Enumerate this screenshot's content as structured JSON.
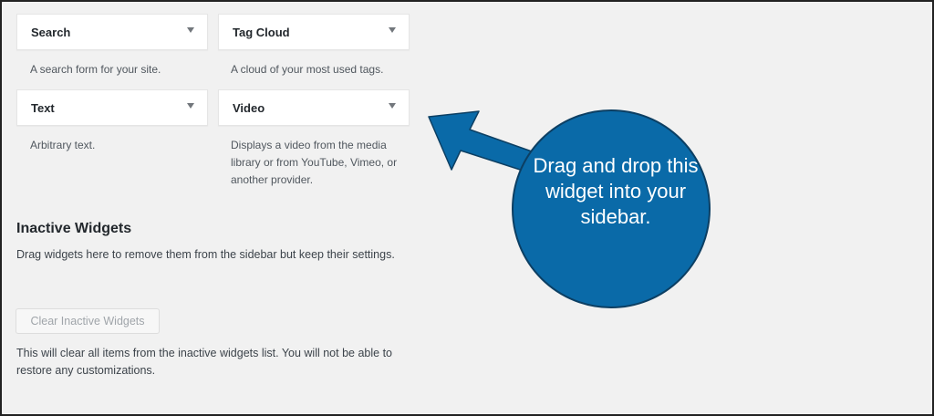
{
  "widgets": [
    {
      "title": "Search",
      "description": "A search form for your site."
    },
    {
      "title": "Tag Cloud",
      "description": "A cloud of your most used tags."
    },
    {
      "title": "Text",
      "description": "Arbitrary text."
    },
    {
      "title": "Video",
      "description": "Displays a video from the media library or from YouTube, Vimeo, or another provider."
    }
  ],
  "inactive": {
    "title": "Inactive Widgets",
    "description": "Drag widgets here to remove them from the sidebar but keep their settings.",
    "clear_button": "Clear Inactive Widgets",
    "clear_note": "This will clear all items from the inactive widgets list. You will not be able to restore any customizations."
  },
  "callout": {
    "text": "Drag and drop this widget into your sidebar.",
    "color": "#0a6aa8"
  },
  "icons": {
    "toggle": "caret-down-icon",
    "callout_arrow": "arrow-icon"
  }
}
